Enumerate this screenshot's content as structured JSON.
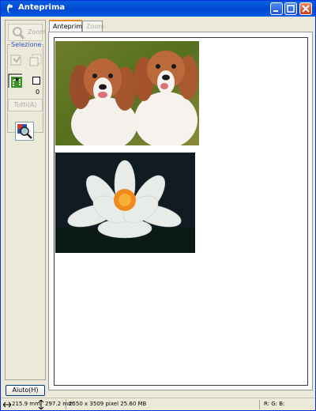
{
  "window": {
    "title": "Anteprima"
  },
  "toolbar": {
    "zoom_label": "Zoom",
    "selection_title": "Selezione",
    "selection_count": "0",
    "all_label": "Tutti(A)",
    "help_label": "Aiuto(H)"
  },
  "tabs": [
    {
      "label": "Anteprima",
      "active": true
    },
    {
      "label": "Zoom",
      "active": false
    }
  ],
  "status": {
    "width": "215.9 mm",
    "height": "297.2 mm",
    "pixels": "2550 x 3509 pixel 25.60 MB",
    "rgb": "R: G: B:"
  },
  "colors": {
    "titlebar": "#0048d0",
    "window_bg": "#ece9d8",
    "selection_title": "#3050c0",
    "active_tab_accent": "#e68b2c"
  },
  "images": [
    {
      "description_icon": "dogs-photo-icon"
    },
    {
      "description_icon": "water-lily-photo-icon"
    }
  ]
}
